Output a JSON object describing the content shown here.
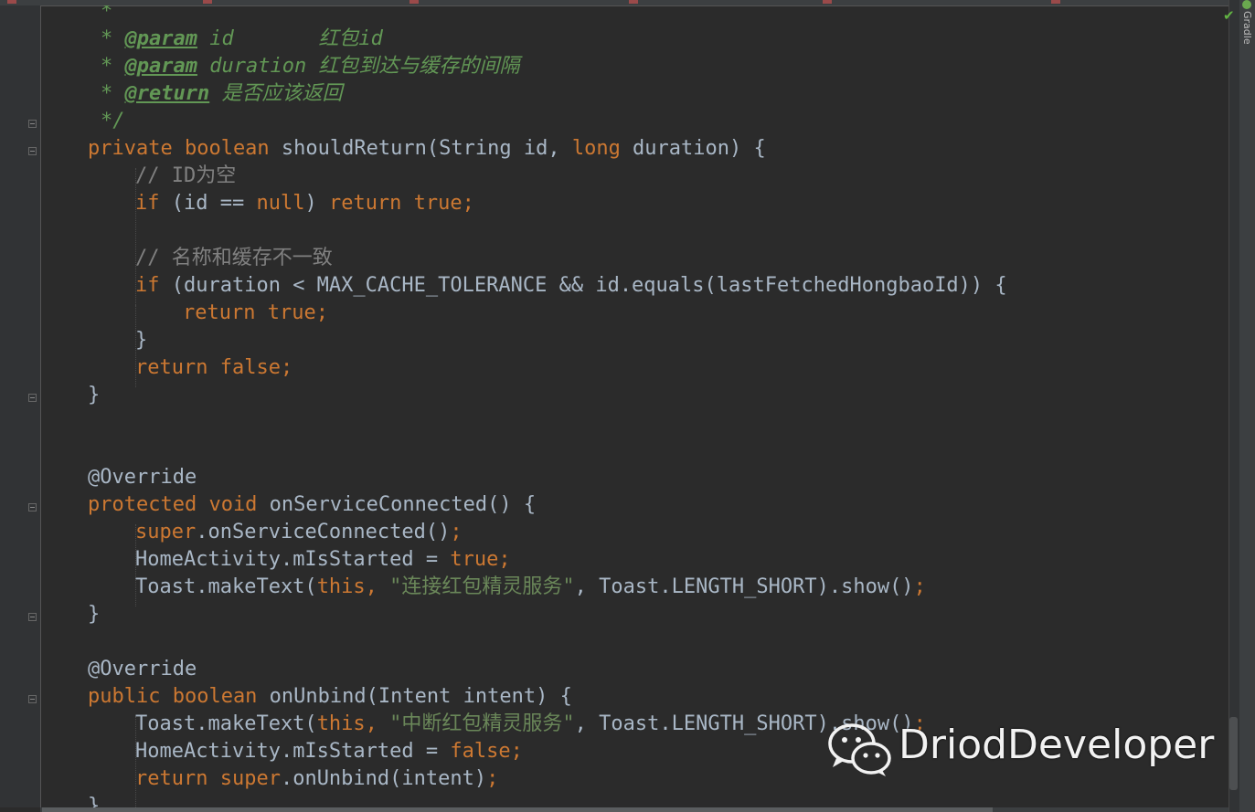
{
  "editor": {
    "lines": {
      "l1": {
        "t1": "*"
      },
      "l2": {
        "t1": "* ",
        "t2": "@param",
        "t3": " id       红包id"
      },
      "l3": {
        "t1": "* ",
        "t2": "@param",
        "t3": " duration 红包到达与缓存的间隔"
      },
      "l4": {
        "t1": "* ",
        "t2": "@return",
        "t3": " 是否应该返回"
      },
      "l5": {
        "t1": "*/"
      },
      "l6": {
        "t1": "private boolean",
        "t2": " shouldReturn(String id, ",
        "t3": "long",
        "t4": " duration) {"
      },
      "l7": {
        "t1": "// ID为空"
      },
      "l8": {
        "t1": "if",
        "t2": " (id == ",
        "t3": "null",
        "t4": ") ",
        "t5": "return true;"
      },
      "l9": {
        "t1": "// 名称和缓存不一致"
      },
      "l10": {
        "t1": "if",
        "t2": " (duration < MAX_CACHE_TOLERANCE && id.equals(lastFetchedHongbaoId)) {"
      },
      "l11": {
        "t1": "return true;"
      },
      "l12": {
        "t1": "}"
      },
      "l13": {
        "t1": "return false;"
      },
      "l14": {
        "t1": "}"
      },
      "l15": {
        "t1": "@Override"
      },
      "l16": {
        "t1": "protected void",
        "t2": " onServiceConnected() {"
      },
      "l17": {
        "t1": "super",
        "t2": ".onServiceConnected()",
        "t3": ";"
      },
      "l18": {
        "t1": "HomeActivity.",
        "t2": "mIsStarted",
        "t3": " = ",
        "t4": "true;"
      },
      "l19": {
        "t1": "Toast.makeText(",
        "t2": "this, ",
        "t3": "\"连接红包精灵服务\"",
        "t4": ", Toast.",
        "t5": "LENGTH_SHORT",
        "t6": ").show()",
        "t7": ";"
      },
      "l20": {
        "t1": "}"
      },
      "l21": {
        "t1": "@Override"
      },
      "l22": {
        "t1": "public boolean",
        "t2": " onUnbind(Intent intent) {"
      },
      "l23": {
        "t1": "Toast.makeText(",
        "t2": "this, ",
        "t3": "\"中断红包精灵服务\"",
        "t4": ", Toast.",
        "t5": "LENGTH_SHORT",
        "t6": ").show()",
        "t7": ";"
      },
      "l24": {
        "t1": "HomeActivity.",
        "t2": "mIsStarted",
        "t3": " = ",
        "t4": "false;"
      },
      "l25": {
        "t1": "return super",
        "t2": ".onUnbind(intent)",
        "t3": ";"
      },
      "l26": {
        "t1": "}"
      }
    }
  },
  "sidebar": {
    "gradle_label": "Gradle"
  },
  "status": {
    "check_icon": "check-icon"
  },
  "watermark": {
    "text": "DriodDeveloper",
    "icon": "wechat-logo-icon"
  },
  "colors": {
    "background": "#2b2b2b",
    "keyword": "#cc7832",
    "comment": "#808080",
    "doc_comment": "#629755",
    "string": "#6a8759",
    "field": "#9876aa",
    "text": "#a9b7c6"
  }
}
